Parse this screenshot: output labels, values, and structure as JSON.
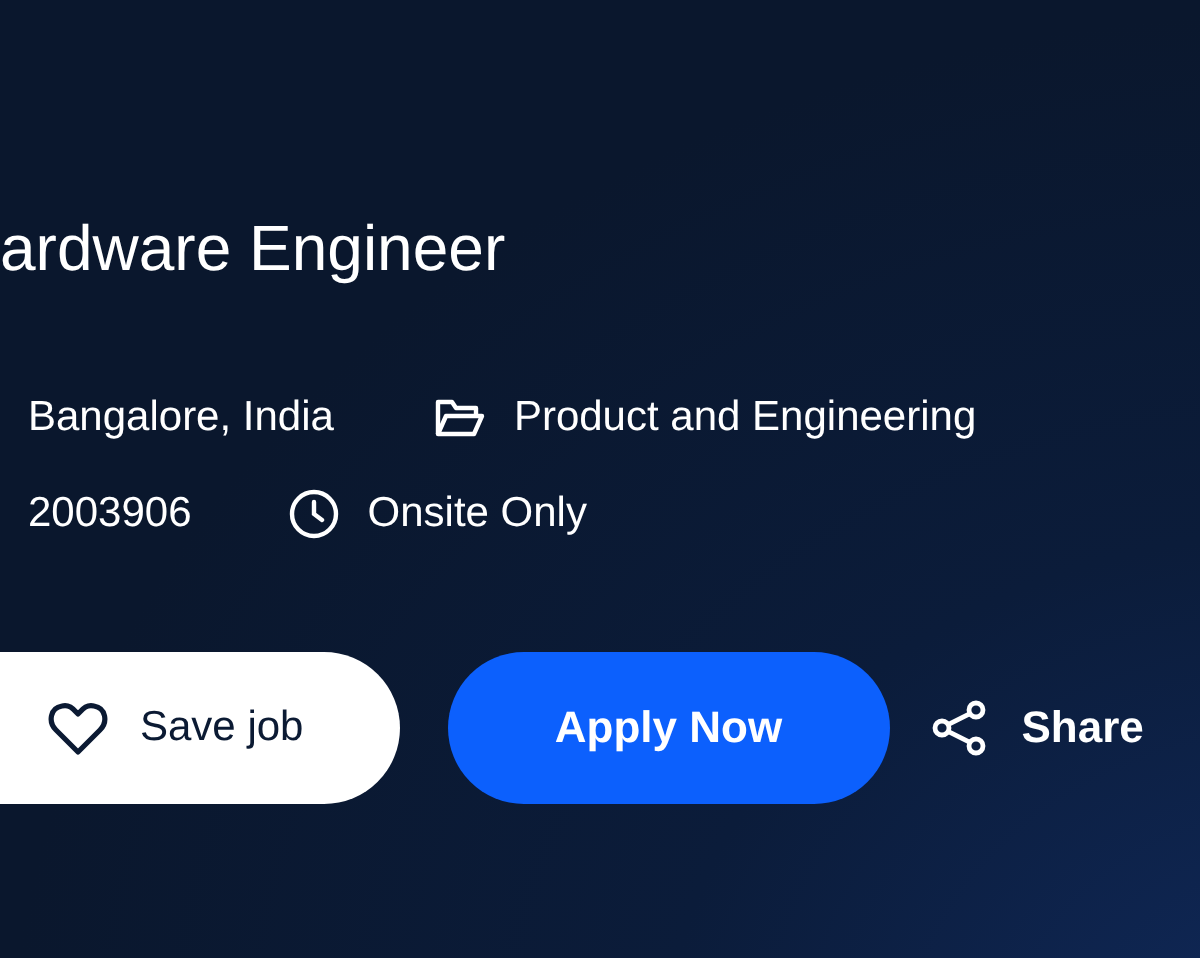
{
  "job": {
    "title": "ardware Engineer",
    "meta": [
      {
        "kind": "text",
        "text": "Bangalore, India"
      },
      {
        "kind": "folder",
        "text": "Product and Engineering"
      },
      {
        "kind": "text",
        "text": "2003906"
      },
      {
        "kind": "clock",
        "text": "Onsite Only"
      }
    ],
    "actions": [
      {
        "kind": "save",
        "label": "Save job"
      },
      {
        "kind": "apply",
        "label": "Apply Now"
      },
      {
        "kind": "share",
        "label": "Share"
      }
    ]
  }
}
